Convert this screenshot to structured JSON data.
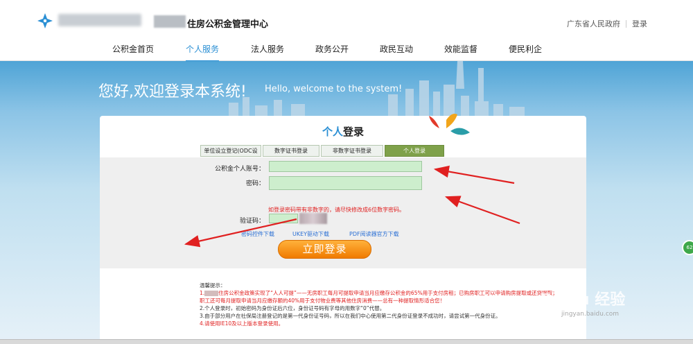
{
  "header": {
    "site_title": "住房公积金管理中心",
    "top_links": [
      "广东省人民政府",
      "登录"
    ]
  },
  "nav": {
    "items": [
      {
        "label": "公积金首页"
      },
      {
        "label": "个人服务"
      },
      {
        "label": "法人服务"
      },
      {
        "label": "政务公开"
      },
      {
        "label": "政民互动"
      },
      {
        "label": "效能监督"
      },
      {
        "label": "便民利企"
      }
    ],
    "active_index": 1
  },
  "banner": {
    "welcome_cn": "您好,欢迎登录本系统!",
    "welcome_en": "Hello, welcome to the system!"
  },
  "login": {
    "title_accent": "个人",
    "title_rest": "登录",
    "tabs": [
      {
        "label": "单位设立登记(ODC设立)"
      },
      {
        "label": "数字证书登录"
      },
      {
        "label": "非数字证书登录"
      },
      {
        "label": "个人登录"
      }
    ],
    "active_tab": 3,
    "account_label": "公积金个人账号：",
    "password_label": "密码：",
    "warning": "如登录密码带有非数字的，请尽快修改成6位数字密码。",
    "captcha_label": "验证码：",
    "links": [
      "密码控件下载",
      "UKEY驱动下载",
      "PDF阅读器官方下载"
    ],
    "submit_label": "立即登录"
  },
  "tips": {
    "heading": "温馨提示：",
    "line1_prefix": "1.",
    "line1": "住房公积金政策实现了“人人可提”——无房职工每月可提取申请当月应缴存公积金的65%用于支付房租；已购房职工可以申请购房提取或还贷提取；职工还可每月提取申请当月应缴存额的40%用于支付物业费等其他住房消费——总有一种提取情形适合您！",
    "line2": "2.个人登录时，初始密码为身份证后六位，身份证号码有字母的用数字“0”代替。",
    "line3": "3.由于部分用户在社保局注册登记的是第一代身份证号码，所以在我们中心使用第二代身份证登录不成功时，请尝试第一代身份证。",
    "line4": "4.请使用IE10及以上版本登录使用。"
  },
  "side_badge": "62",
  "watermark": {
    "brand": "Baidu 经验",
    "url": "jingyan.baidu.com"
  },
  "colors": {
    "accent": "#2a8fd4",
    "active_tab": "#7fa14a",
    "button": "#f07b00",
    "warning": "#e02020",
    "arrow": "#e02020"
  }
}
